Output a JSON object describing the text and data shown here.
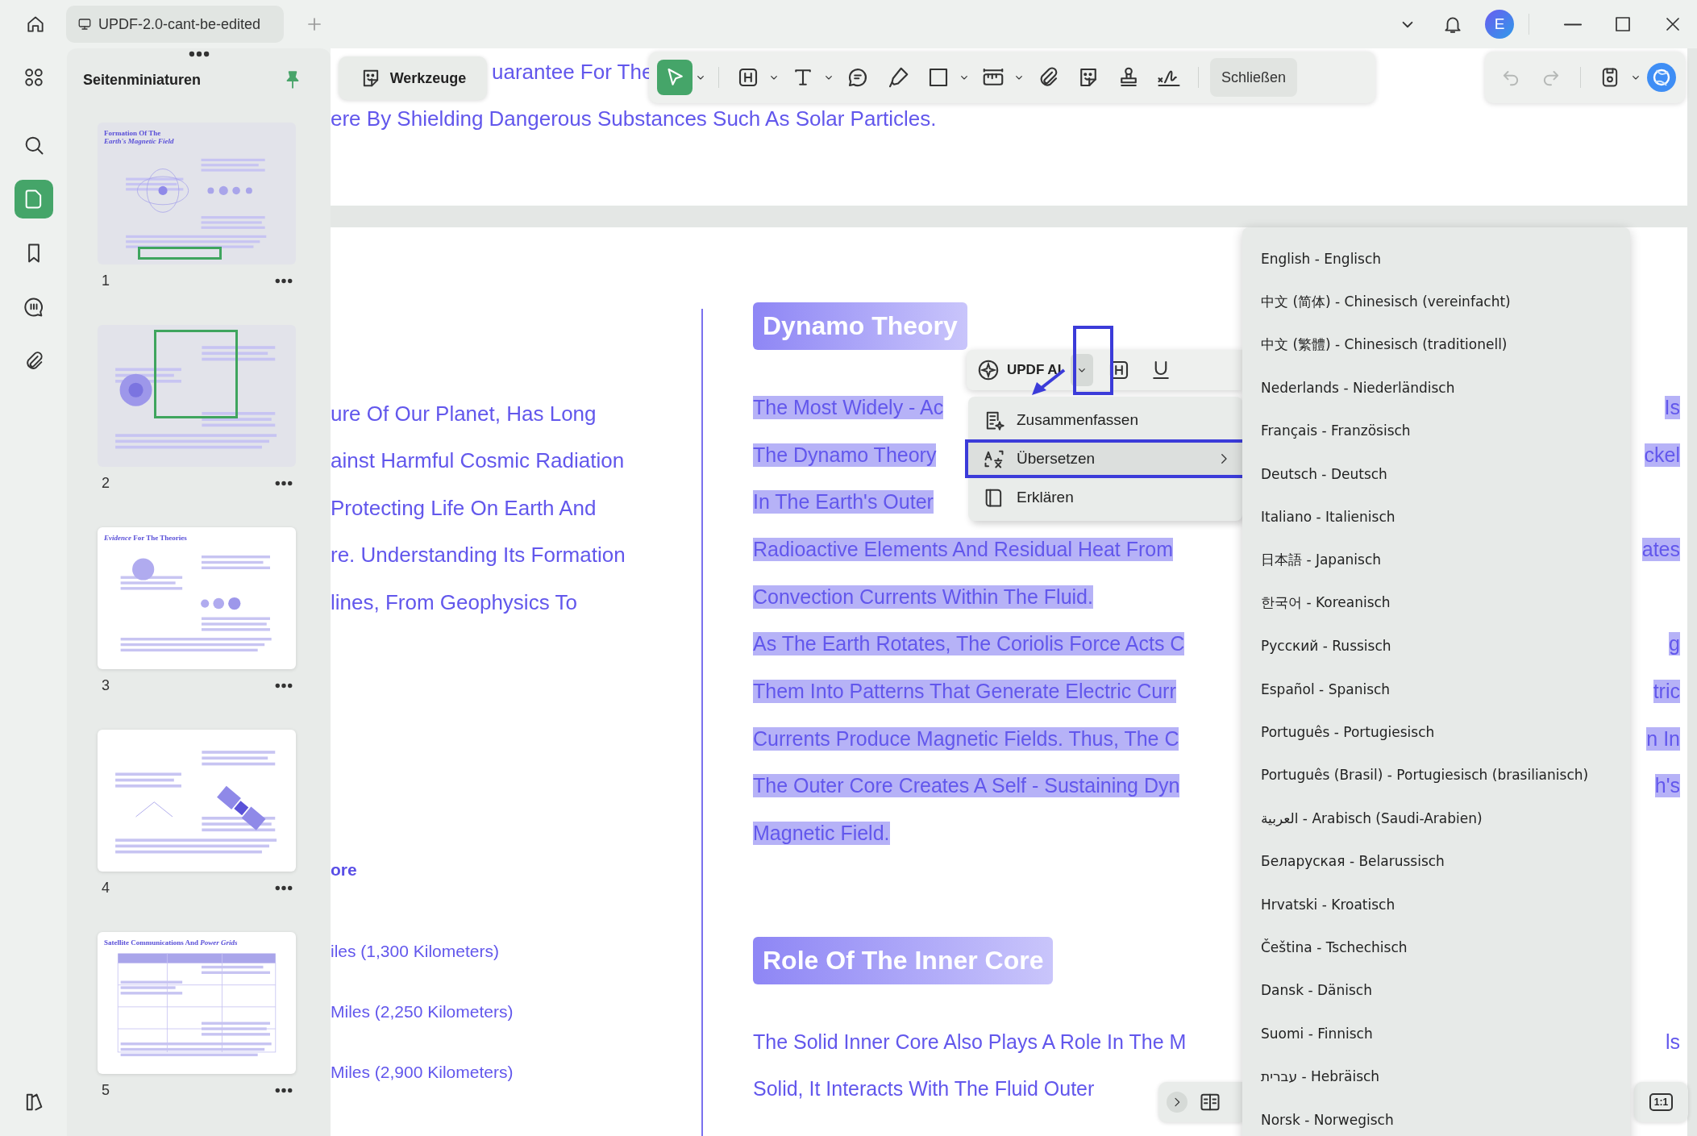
{
  "title_bar": {
    "tab": {
      "title": "UPDF-2.0-cant-be-edited"
    },
    "avatar": {
      "initial": "E"
    }
  },
  "rail": {
    "items": [
      {
        "kind": "grid",
        "selected": false
      },
      {
        "kind": "search",
        "selected": false
      },
      {
        "kind": "pages",
        "selected": true
      },
      {
        "kind": "bookmark",
        "selected": false
      },
      {
        "kind": "comment",
        "selected": false
      },
      {
        "kind": "attachment",
        "selected": false
      }
    ]
  },
  "thumbnails_panel": {
    "title": "Seitenminiaturen",
    "pinned": true,
    "pages": [
      {
        "number": "1",
        "title": "Formation Of The",
        "subtitle": "Earth's Magnetic Field",
        "kind": "rings",
        "in_view": true
      },
      {
        "number": "2",
        "kind": "sphere",
        "in_view": true
      },
      {
        "number": "3",
        "title": "*Evidence* For The Theories",
        "kind": "spheres",
        "in_view": false
      },
      {
        "number": "4",
        "kind": "satellite",
        "in_view": false
      },
      {
        "number": "5",
        "title": "Satellite Communications And *Power Grids*",
        "kind": "table",
        "in_view": false
      }
    ]
  },
  "tools_button": {
    "label": "Werkzeuge"
  },
  "toolbar": {
    "tools": [
      {
        "kind": "select",
        "selected": true,
        "dropdown": true
      },
      {
        "kind": "heading",
        "selected": false,
        "dropdown": true
      },
      {
        "kind": "text",
        "selected": false,
        "dropdown": true
      },
      {
        "kind": "comment",
        "selected": false,
        "dropdown": false
      },
      {
        "kind": "highlighter",
        "selected": false,
        "dropdown": false
      },
      {
        "kind": "rectangle",
        "selected": false,
        "dropdown": true
      },
      {
        "kind": "ruler",
        "selected": false,
        "dropdown": true
      },
      {
        "kind": "attachment",
        "selected": false,
        "dropdown": false
      },
      {
        "kind": "sticker",
        "selected": false,
        "dropdown": false
      },
      {
        "kind": "stamp",
        "selected": false,
        "dropdown": false
      },
      {
        "kind": "signature",
        "selected": false,
        "dropdown": false
      }
    ],
    "close_label": "Schließen"
  },
  "right_toolbar": {
    "items": [
      {
        "kind": "undo",
        "disabled": true,
        "dropdown": false
      },
      {
        "kind": "redo",
        "disabled": true,
        "dropdown": false
      },
      {
        "kind": "save",
        "disabled": false,
        "dropdown": true
      }
    ]
  },
  "page_1": {
    "lines": [
      "uarantee For The",
      "ere By Shielding Dangerous Substances Such As Solar Particles."
    ]
  },
  "page_2": {
    "left_column": {
      "lines": [
        "ure Of Our Planet, Has Long",
        "ainst Harmful Cosmic Radiation",
        "Protecting Life On Earth And",
        "re. Understanding Its Formation",
        "lines, From Geophysics To"
      ],
      "subheading": "ore",
      "measurements": [
        "iles (1,300 Kilometers)",
        "Miles (2,250 Kilometers)",
        "Miles (2,900 Kilometers)"
      ]
    },
    "right_column": {
      "sections": [
        {
          "heading": "Dynamo Theory",
          "lines": [
            {
              "start": "The Most Widely - Ac",
              "end": "Is",
              "selected": true
            },
            {
              "start": "The Dynamo Theory",
              "end": "ckel",
              "selected": true
            },
            {
              "start": "In The Earth's Outer",
              "selected": true
            },
            {
              "start": "Radioactive Elements And Residual Heat From",
              "end": "ates",
              "selected": true
            },
            {
              "start": "Convection Currents Within The Fluid.",
              "selected": true
            },
            {
              "start": "As The Earth Rotates, The Coriolis Force Acts C",
              "end": "g",
              "selected": true
            },
            {
              "start": "Them Into Patterns That Generate Electric Curr",
              "end": "tric",
              "selected": true
            },
            {
              "start": "Currents Produce Magnetic Fields. Thus, The C",
              "end": "n In",
              "selected": true
            },
            {
              "start": "The Outer Core Creates A Self - Sustaining Dyn",
              "end": "h's",
              "selected": true
            },
            {
              "start": "Magnetic Field.",
              "selected": true
            }
          ]
        },
        {
          "heading": "Role Of The Inner Core",
          "lines": [
            {
              "start": "The Solid Inner Core Also Plays A Role In The M",
              "end": "ls",
              "selected": false
            },
            {
              "start": "Solid, It Interacts With The Fluid Outer",
              "selected": false
            }
          ]
        }
      ]
    }
  },
  "ai_toolbar": {
    "label": "UPDF AI",
    "dropdown_open": true,
    "callout": true,
    "tools": [
      {
        "kind": "heading"
      },
      {
        "kind": "underline"
      }
    ]
  },
  "ai_menu": {
    "items": [
      {
        "kind": "summarize",
        "label": "Zusammenfassen",
        "selected": false,
        "submenu": false
      },
      {
        "kind": "translate",
        "label": "Übersetzen",
        "selected": true,
        "submenu": true
      },
      {
        "kind": "explain",
        "label": "Erklären",
        "selected": false,
        "submenu": false
      }
    ]
  },
  "language_menu": {
    "items": [
      "English - Englisch",
      "中文 (简体) - Chinesisch (vereinfacht)",
      "中文 (繁體) - Chinesisch (traditionell)",
      "Nederlands - Niederländisch",
      "Français - Französisch",
      "Deutsch - Deutsch",
      "Italiano - Italienisch",
      "日本語 - Japanisch",
      "한국어 - Koreanisch",
      "Русский - Russisch",
      "Español - Spanisch",
      "Português - Portugiesisch",
      "Português (Brasil) - Portugiesisch (brasilianisch)",
      "العربية - Arabisch (Saudi-Arabien)",
      "Беларуская - Belarussisch",
      "Hrvatski - Kroatisch",
      "Čeština - Tschechisch",
      "Dansk - Dänisch",
      "Suomi - Finnisch",
      "עברית - Hebräisch",
      "Norsk - Norwegisch"
    ]
  },
  "view_controls": {
    "zoom_reset": "1:1"
  }
}
